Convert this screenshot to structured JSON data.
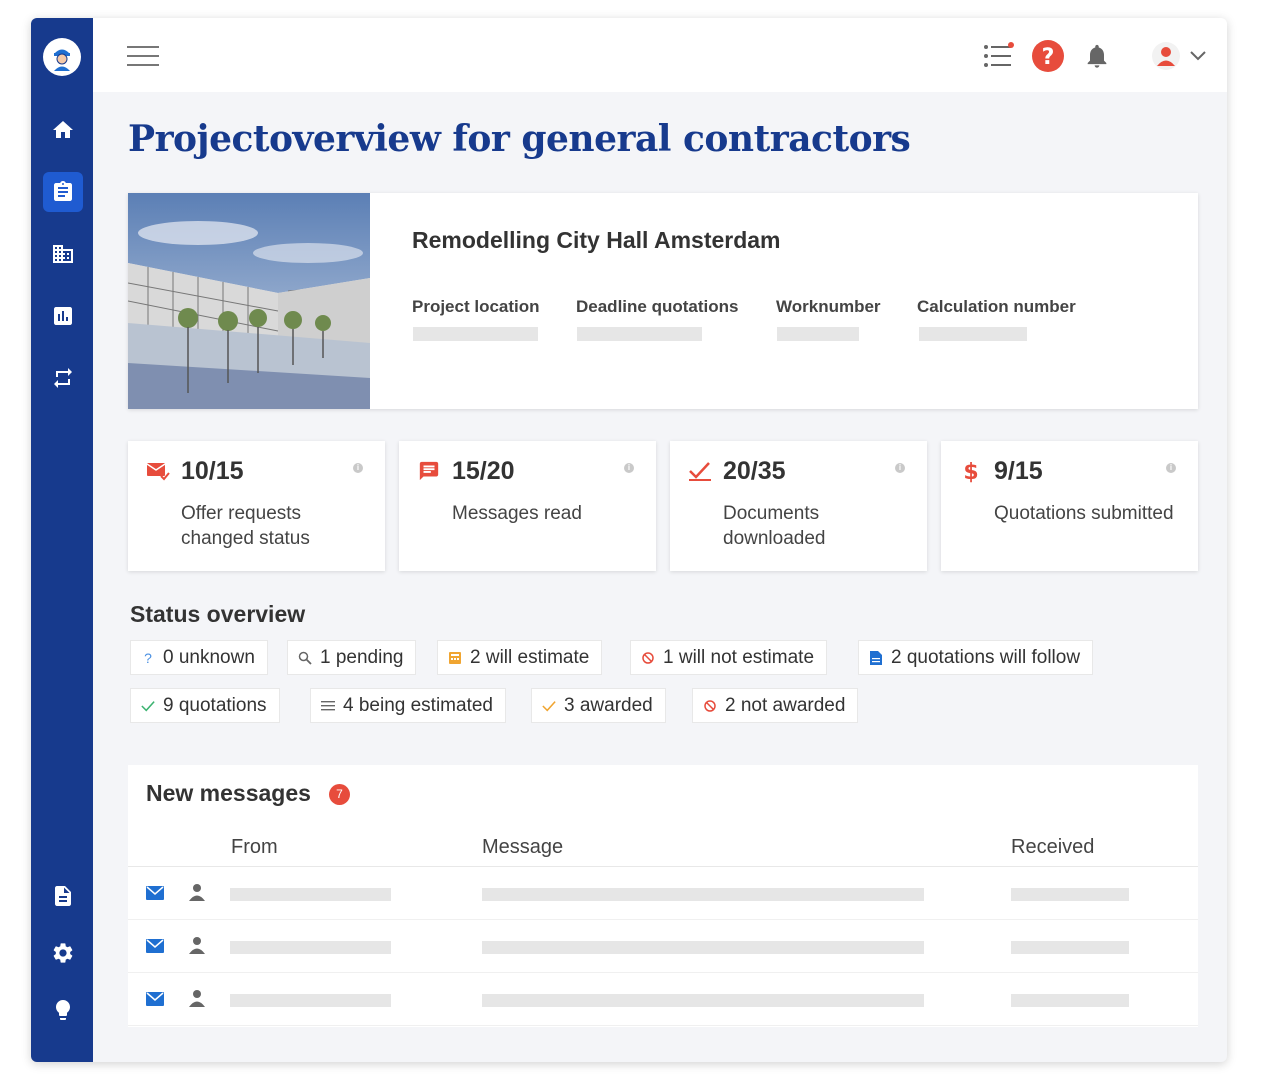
{
  "page": {
    "title": "Projectoverview for general contractors"
  },
  "project": {
    "name": "Remodelling City Hall Amsterdam",
    "fields": [
      {
        "label": "Project location"
      },
      {
        "label": "Deadline quotations"
      },
      {
        "label": "Worknumber"
      },
      {
        "label": "Calculation number"
      }
    ]
  },
  "stats": [
    {
      "value": "10/15",
      "label": "Offer requests changed status",
      "icon": "mail-check-icon"
    },
    {
      "value": "15/20",
      "label": "Messages read",
      "icon": "chat-icon"
    },
    {
      "value": "20/35",
      "label": "Documents downloaded",
      "icon": "check-icon"
    },
    {
      "value": "9/15",
      "label": "Quotations submitted",
      "icon": "dollar-icon"
    }
  ],
  "status": {
    "title": "Status overview",
    "chips": [
      {
        "label": "0 unknown",
        "icon": "question-icon"
      },
      {
        "label": "1 pending",
        "icon": "search-icon"
      },
      {
        "label": "2 will estimate",
        "icon": "calculator-icon"
      },
      {
        "label": "1 will not estimate",
        "icon": "block-icon"
      },
      {
        "label": "2 quotations will follow",
        "icon": "document-icon"
      },
      {
        "label": "9 quotations",
        "icon": "check-icon"
      },
      {
        "label": "4 being estimated",
        "icon": "lines-icon"
      },
      {
        "label": "3 awarded",
        "icon": "check-icon"
      },
      {
        "label": "2 not awarded",
        "icon": "block-icon"
      }
    ]
  },
  "messages": {
    "title": "New messages",
    "count": "7",
    "columns": {
      "from": "From",
      "message": "Message",
      "received": "Received"
    },
    "rows": 3
  },
  "colors": {
    "brand": "#173a8d",
    "accent": "#1f5bd1",
    "alert": "#e74c3c"
  }
}
